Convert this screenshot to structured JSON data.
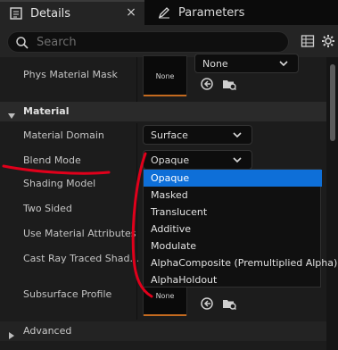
{
  "tabs": [
    {
      "label": "Details",
      "icon": "details-icon",
      "active": true
    },
    {
      "label": "Parameters",
      "icon": "pencil-icon",
      "active": false
    }
  ],
  "search": {
    "placeholder": "Search"
  },
  "properties": {
    "phys_material_mask": {
      "label": "Phys Material Mask",
      "thumb": "None",
      "value": "None"
    },
    "material_section": "Material",
    "material_domain": {
      "label": "Material Domain",
      "value": "Surface"
    },
    "blend_mode": {
      "label": "Blend Mode",
      "value": "Opaque"
    },
    "shading_model": {
      "label": "Shading Model"
    },
    "two_sided": {
      "label": "Two Sided"
    },
    "use_material_attributes": {
      "label": "Use Material Attributes"
    },
    "cast_ray_traced": {
      "label": "Cast Ray Traced Shad..."
    },
    "subsurface_profile": {
      "label": "Subsurface Profile",
      "thumb": "None"
    },
    "advanced_section": "Advanced"
  },
  "dropdown": {
    "options": [
      "Opaque",
      "Masked",
      "Translucent",
      "Additive",
      "Modulate",
      "AlphaComposite (Premultiplied Alpha)",
      "AlphaHoldout"
    ],
    "selected_index": 0
  },
  "colors": {
    "accent": "#0e6fd8",
    "thumb_underline": "#c46a1f",
    "annotation": "#e0001b"
  }
}
